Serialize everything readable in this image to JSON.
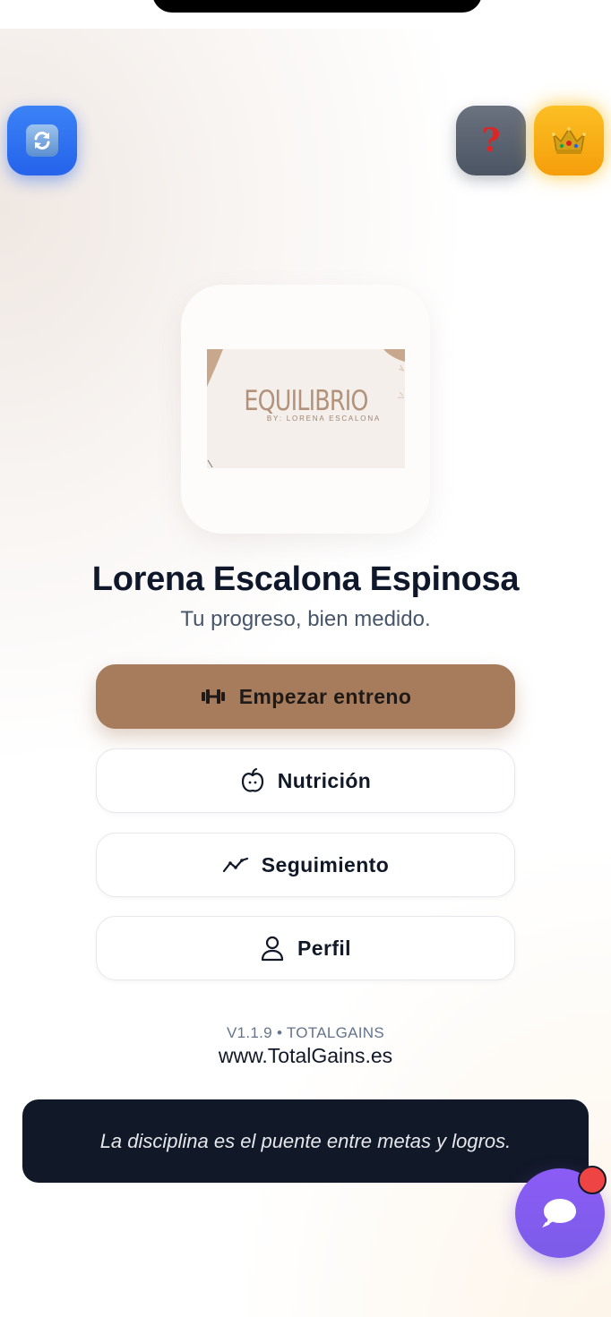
{
  "top_actions": {
    "refresh_icon": "refresh-icon",
    "help_icon": "question-mark-icon",
    "help_glyph": "?",
    "premium_icon": "crown-icon",
    "premium_glyph": "👑"
  },
  "logo": {
    "brand": "EQUILIBRIO",
    "byline": "BY: LORENA ESCALONA"
  },
  "profile": {
    "name": "Lorena Escalona Espinosa",
    "tagline": "Tu progreso, bien medido."
  },
  "menu": {
    "start_workout": {
      "label": "Empezar entreno",
      "icon": "dumbbell-icon"
    },
    "nutrition": {
      "label": "Nutrición",
      "icon": "apple-icon"
    },
    "tracking": {
      "label": "Seguimiento",
      "icon": "trend-line-icon"
    },
    "profile": {
      "label": "Perfil",
      "icon": "user-icon"
    }
  },
  "footer": {
    "version": "V1.1.9 • TOTALGAINS",
    "website": "www.TotalGains.es"
  },
  "quote": {
    "text": "La disciplina es el puente entre metas y logros."
  },
  "chat": {
    "icon": "chat-bubble-icon"
  },
  "colors": {
    "primary_button": "#a67c5d",
    "refresh_button": "#2563eb",
    "help_button": "#4b5563",
    "premium_button": "#f59e0b",
    "chat_button": "#7c5ce8",
    "quote_background": "#111827",
    "title_text": "#0f172a"
  }
}
